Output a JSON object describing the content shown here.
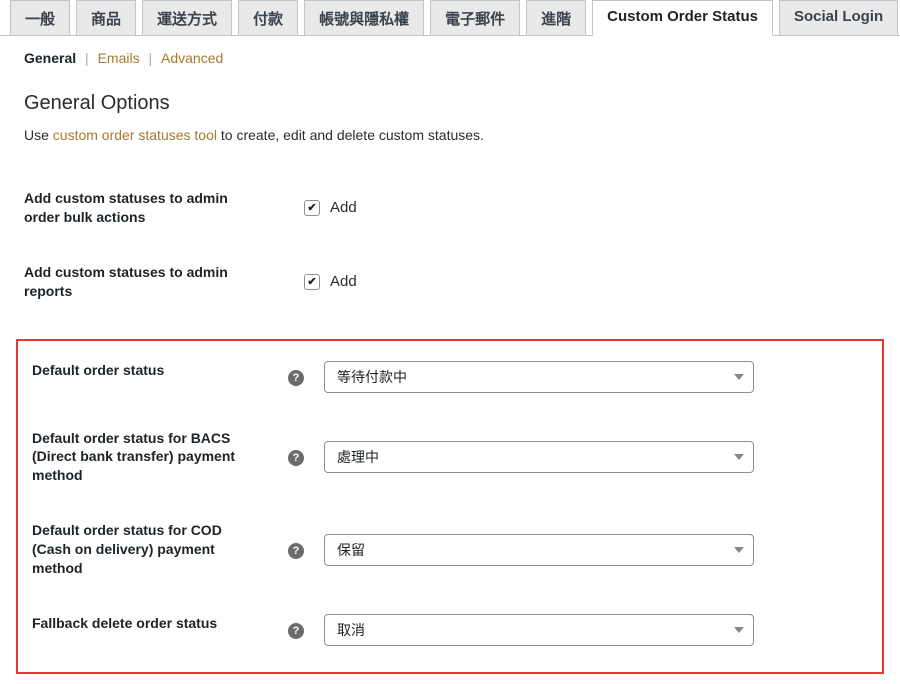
{
  "tabs": [
    {
      "label": "一般",
      "active": false
    },
    {
      "label": "商品",
      "active": false
    },
    {
      "label": "運送方式",
      "active": false
    },
    {
      "label": "付款",
      "active": false
    },
    {
      "label": "帳號與隱私權",
      "active": false
    },
    {
      "label": "電子郵件",
      "active": false
    },
    {
      "label": "進階",
      "active": false
    },
    {
      "label": "Custom Order Status",
      "active": true
    },
    {
      "label": "Social Login",
      "active": false
    }
  ],
  "subnav": {
    "general": "General",
    "emails": "Emails",
    "advanced": "Advanced"
  },
  "section_title": "General Options",
  "intro": {
    "prefix": "Use ",
    "link": "custom order statuses tool",
    "suffix": " to create, edit and delete custom statuses."
  },
  "fields": {
    "bulk_actions": {
      "label": "Add custom statuses to admin order bulk actions",
      "checkbox_label": "Add",
      "checked": true
    },
    "reports": {
      "label": "Add custom statuses to admin reports",
      "checkbox_label": "Add",
      "checked": true
    },
    "default_status": {
      "label": "Default order status",
      "value": "等待付款中"
    },
    "default_bacs": {
      "label": "Default order status for BACS (Direct bank transfer) payment method",
      "value": "處理中"
    },
    "default_cod": {
      "label": "Default order status for COD (Cash on delivery) payment method",
      "value": "保留"
    },
    "fallback": {
      "label": "Fallback delete order status",
      "value": "取消"
    }
  }
}
